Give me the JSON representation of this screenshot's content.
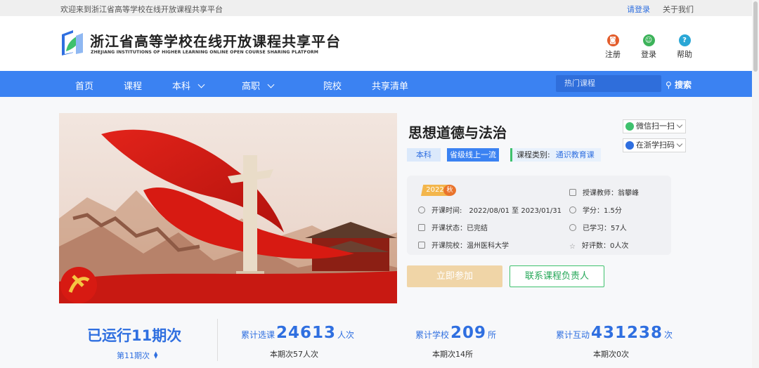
{
  "topbar": {
    "welcome": "欢迎来到浙江省高等学校在线开放课程共享平台",
    "login": "请登录",
    "about": "关于我们"
  },
  "header": {
    "title": "浙江省高等学校在线开放课程共享平台",
    "subtitle": "ZHEJIANG INSTITUTIONS OF HIGHER LEARNING ONLINE OPEN COURSE SHARING PLATFORM",
    "actions": [
      {
        "label": "注册",
        "icon": "register-icon",
        "color": "#e35d2c"
      },
      {
        "label": "登录",
        "icon": "user-icon",
        "color": "#3db35a"
      },
      {
        "label": "帮助",
        "icon": "help-icon",
        "color": "#2aa7d6",
        "glyph": "?"
      }
    ]
  },
  "nav": {
    "items": [
      "首页",
      "课程",
      "本科",
      "高职",
      "院校",
      "共享清单"
    ],
    "search_placeholder": "热门课程",
    "search_label": "搜索"
  },
  "course": {
    "title": "思想道德与法治",
    "tags": [
      "本科",
      "省级线上一流"
    ],
    "category_label": "课程类别:",
    "category_value": "通识教育课",
    "share_wechat": "微信扫一扫",
    "share_zjx": "在浙学扫码",
    "term_year": "2022",
    "term_season": "秋",
    "teacher": "授课教师：翁攀峰",
    "time": "开课时间:　2022/08/01 至 2023/01/31",
    "credit": "学分：1.5分",
    "status": "开课状态：已完结",
    "learned": "已学习：57人",
    "school": "开课院校：温州医科大学",
    "rating": "好评数：0人次",
    "join_label": "立即参加",
    "contact_label": "联系课程负责人"
  },
  "stats": {
    "run_label": "已运行11期次",
    "period": "第11期次",
    "items": [
      {
        "label": "累计选课",
        "value": "24613",
        "unit": "人次",
        "sub": "本期次57人次"
      },
      {
        "label": "累计学校",
        "value": "209",
        "unit": "所",
        "sub": "本期次14所"
      },
      {
        "label": "累计互动",
        "value": "431238",
        "unit": "次",
        "sub": "本期次0次"
      }
    ]
  },
  "colors": {
    "primary": "#3b82f2",
    "accent_green": "#3ec16d",
    "join_button": "#f0d5a7"
  }
}
